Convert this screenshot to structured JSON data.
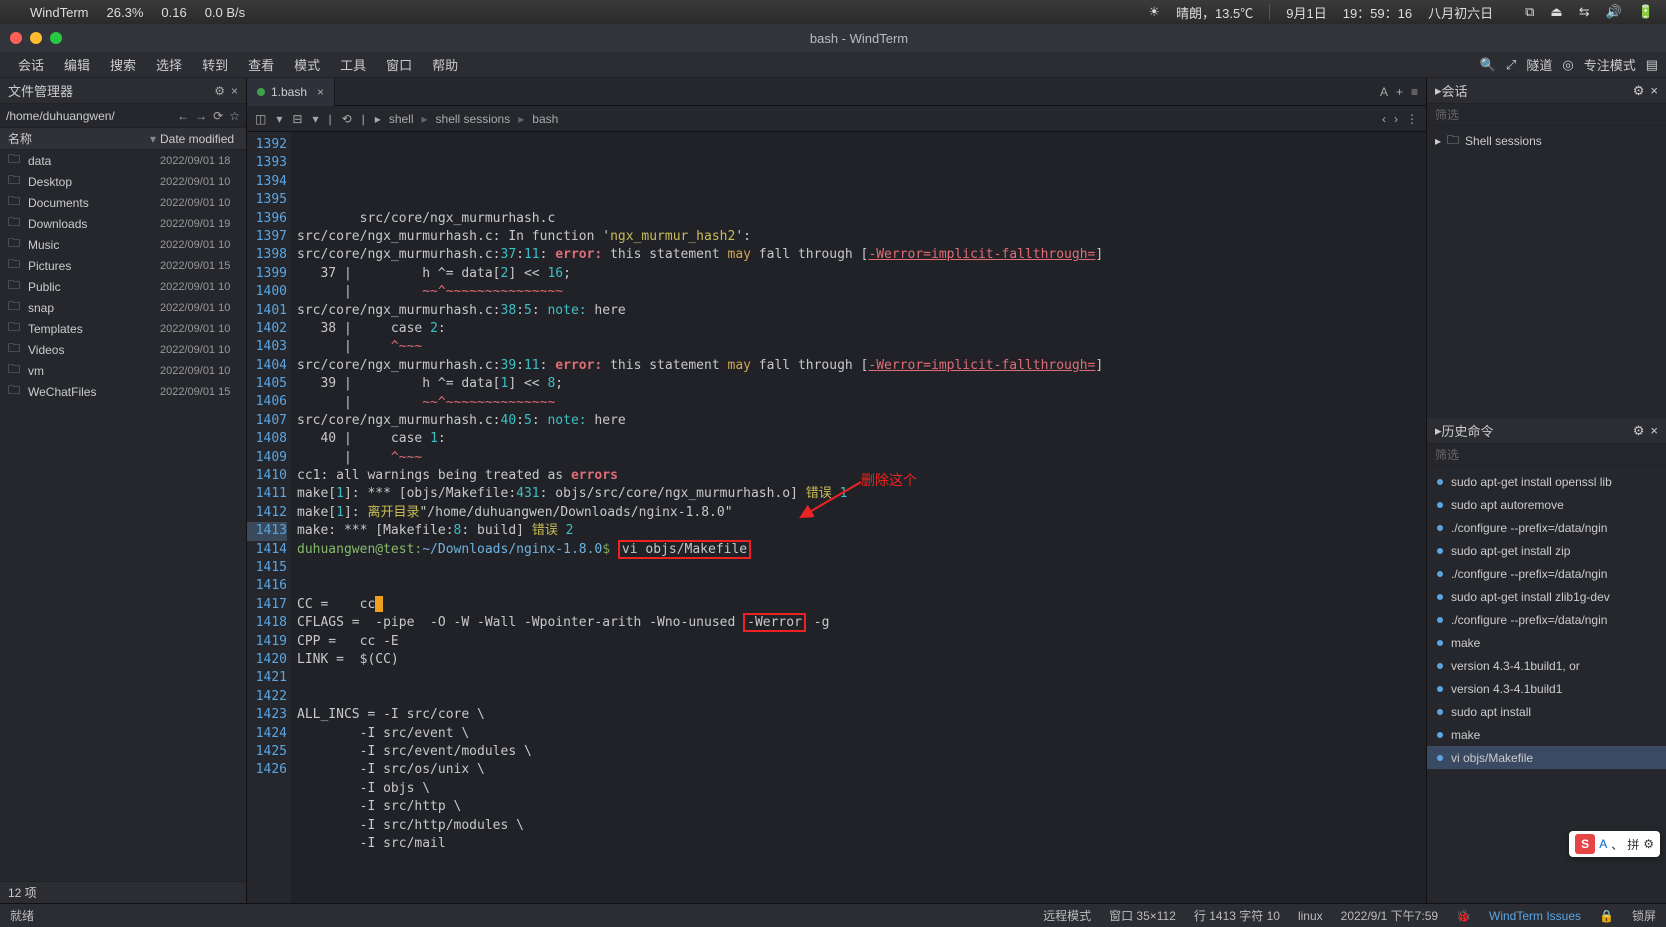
{
  "menubar": {
    "app": "WindTerm",
    "cpu": "26.3%",
    "load": "0.16",
    "net": "0.0 B/s",
    "weather": "晴朗，13.5℃",
    "date": "9月1日",
    "time": "19：59：16",
    "lunar": "八月初六日"
  },
  "titlebar": {
    "title": "bash - WindTerm"
  },
  "appmenu": {
    "items": [
      "会话",
      "编辑",
      "搜索",
      "选择",
      "转到",
      "查看",
      "模式",
      "工具",
      "窗口",
      "帮助"
    ],
    "right": {
      "tunnel": "隧道",
      "focus": "专注模式"
    }
  },
  "left": {
    "title": "文件管理器",
    "path": "/home/duhuangwen/",
    "cols": {
      "name": "名称",
      "date": "Date modified"
    },
    "files": [
      {
        "name": "data",
        "date": "2022/09/01 18"
      },
      {
        "name": "Desktop",
        "date": "2022/09/01 10"
      },
      {
        "name": "Documents",
        "date": "2022/09/01 10"
      },
      {
        "name": "Downloads",
        "date": "2022/09/01 19"
      },
      {
        "name": "Music",
        "date": "2022/09/01 10"
      },
      {
        "name": "Pictures",
        "date": "2022/09/01 15"
      },
      {
        "name": "Public",
        "date": "2022/09/01 10"
      },
      {
        "name": "snap",
        "date": "2022/09/01 10"
      },
      {
        "name": "Templates",
        "date": "2022/09/01 10"
      },
      {
        "name": "Videos",
        "date": "2022/09/01 10"
      },
      {
        "name": "vm",
        "date": "2022/09/01 10"
      },
      {
        "name": "WeChatFiles",
        "date": "2022/09/01 15"
      }
    ],
    "status": "12 项"
  },
  "tab": {
    "label": "1.bash"
  },
  "breadcrumb": [
    "shell",
    "shell sessions",
    "bash"
  ],
  "lines": [
    {
      "n": 1392,
      "segs": [
        {
          "t": "        src/core/ngx_murmurhash.c"
        }
      ]
    },
    {
      "n": 1393,
      "segs": [
        {
          "t": "src/core/ngx_murmurhash.c: In function '"
        },
        {
          "t": "ngx_murmur_hash2",
          "c": "cl-yellow"
        },
        {
          "t": "':"
        }
      ]
    },
    {
      "n": 1394,
      "segs": [
        {
          "t": "src/core/ngx_murmurhash.c:"
        },
        {
          "t": "37",
          "c": "cl-num"
        },
        {
          "t": ":"
        },
        {
          "t": "11",
          "c": "cl-num"
        },
        {
          "t": ": "
        },
        {
          "t": "error:",
          "c": "cl-error"
        },
        {
          "t": " this statement "
        },
        {
          "t": "may",
          "c": "cl-warn"
        },
        {
          "t": " fall through ["
        },
        {
          "t": "-Werror=implicit-fallthrough=",
          "c": "cl-link"
        },
        {
          "t": "]"
        }
      ]
    },
    {
      "n": 1395,
      "segs": [
        {
          "t": "   37 |         h ^= data["
        },
        {
          "t": "2",
          "c": "cl-num"
        },
        {
          "t": "] << "
        },
        {
          "t": "16",
          "c": "cl-num"
        },
        {
          "t": ";"
        }
      ]
    },
    {
      "n": 1396,
      "segs": [
        {
          "t": "      |         ",
          "c": "cl-plain"
        },
        {
          "t": "~~^~~~~~~~~~~~~~~~",
          "c": "cl-red"
        }
      ]
    },
    {
      "n": 1397,
      "segs": [
        {
          "t": "src/core/ngx_murmurhash.c:"
        },
        {
          "t": "38",
          "c": "cl-num"
        },
        {
          "t": ":"
        },
        {
          "t": "5",
          "c": "cl-num"
        },
        {
          "t": ": "
        },
        {
          "t": "note:",
          "c": "cl-note"
        },
        {
          "t": " here"
        }
      ]
    },
    {
      "n": 1398,
      "segs": [
        {
          "t": "   38 |     case "
        },
        {
          "t": "2",
          "c": "cl-num"
        },
        {
          "t": ":"
        }
      ]
    },
    {
      "n": 1399,
      "segs": [
        {
          "t": "      |     ",
          "c": "cl-plain"
        },
        {
          "t": "^~~~",
          "c": "cl-red"
        }
      ]
    },
    {
      "n": 1400,
      "segs": [
        {
          "t": "src/core/ngx_murmurhash.c:"
        },
        {
          "t": "39",
          "c": "cl-num"
        },
        {
          "t": ":"
        },
        {
          "t": "11",
          "c": "cl-num"
        },
        {
          "t": ": "
        },
        {
          "t": "error:",
          "c": "cl-error"
        },
        {
          "t": " this statement "
        },
        {
          "t": "may",
          "c": "cl-warn"
        },
        {
          "t": " fall through ["
        },
        {
          "t": "-Werror=implicit-fallthrough=",
          "c": "cl-link"
        },
        {
          "t": "]"
        }
      ]
    },
    {
      "n": 1401,
      "segs": [
        {
          "t": "   39 |         h ^= data["
        },
        {
          "t": "1",
          "c": "cl-num"
        },
        {
          "t": "] << "
        },
        {
          "t": "8",
          "c": "cl-num"
        },
        {
          "t": ";"
        }
      ]
    },
    {
      "n": 1402,
      "segs": [
        {
          "t": "      |         ",
          "c": "cl-plain"
        },
        {
          "t": "~~^~~~~~~~~~~~~~~",
          "c": "cl-red"
        }
      ]
    },
    {
      "n": 1403,
      "segs": [
        {
          "t": "src/core/ngx_murmurhash.c:"
        },
        {
          "t": "40",
          "c": "cl-num"
        },
        {
          "t": ":"
        },
        {
          "t": "5",
          "c": "cl-num"
        },
        {
          "t": ": "
        },
        {
          "t": "note:",
          "c": "cl-note"
        },
        {
          "t": " here"
        }
      ]
    },
    {
      "n": 1404,
      "segs": [
        {
          "t": "   40 |     case "
        },
        {
          "t": "1",
          "c": "cl-num"
        },
        {
          "t": ":"
        }
      ]
    },
    {
      "n": 1405,
      "segs": [
        {
          "t": "      |     ",
          "c": "cl-plain"
        },
        {
          "t": "^~~~",
          "c": "cl-red"
        }
      ]
    },
    {
      "n": 1406,
      "segs": [
        {
          "t": "cc1: all warnings being treated as "
        },
        {
          "t": "errors",
          "c": "cl-error"
        }
      ]
    },
    {
      "n": 1407,
      "segs": [
        {
          "t": "make["
        },
        {
          "t": "1",
          "c": "cl-num"
        },
        {
          "t": "]: *** [objs/Makefile:"
        },
        {
          "t": "431",
          "c": "cl-num"
        },
        {
          "t": ": objs/src/core/ngx_murmurhash.o] "
        },
        {
          "t": "错误",
          "c": "cl-yellow"
        },
        {
          "t": " "
        },
        {
          "t": "1",
          "c": "cl-num"
        }
      ]
    },
    {
      "n": 1408,
      "segs": [
        {
          "t": "make["
        },
        {
          "t": "1",
          "c": "cl-num"
        },
        {
          "t": "]: "
        },
        {
          "t": "离开目录",
          "c": "cl-yellow"
        },
        {
          "t": "\"/home/duhuangwen/Downloads/nginx-1.8.0\""
        }
      ]
    },
    {
      "n": 1409,
      "segs": [
        {
          "t": "make: *** [Makefile:"
        },
        {
          "t": "8",
          "c": "cl-num"
        },
        {
          "t": ": build] "
        },
        {
          "t": "错误",
          "c": "cl-yellow"
        },
        {
          "t": " "
        },
        {
          "t": "2",
          "c": "cl-num"
        }
      ]
    },
    {
      "n": 1410,
      "hl": true,
      "segs": [
        {
          "t": "duhuangwen@test",
          "c": "cl-bgreen"
        },
        {
          "t": ":",
          "c": "cl-green"
        },
        {
          "t": "~/Downloads/nginx-1.8.0",
          "c": "cl-blue"
        },
        {
          "t": "$",
          "c": "cl-green"
        },
        {
          "t": " "
        },
        {
          "t": "vi objs/Makefile",
          "box": true
        }
      ]
    },
    {
      "n": 1411,
      "segs": [
        {
          "t": ""
        }
      ]
    },
    {
      "n": 1412,
      "segs": [
        {
          "t": ""
        }
      ]
    },
    {
      "n": 1413,
      "mark": true,
      "segs": [
        {
          "t": "CC =    cc",
          "cursor": true
        }
      ]
    },
    {
      "n": 1414,
      "segs": [
        {
          "t": "CFLAGS =  -pipe  -O -W -Wall -Wpointer-arith -Wno-unused "
        },
        {
          "t": "-Werror",
          "box": true
        },
        {
          "t": " -g"
        }
      ]
    },
    {
      "n": 1415,
      "segs": [
        {
          "t": "CPP =   cc -E"
        }
      ]
    },
    {
      "n": 1416,
      "segs": [
        {
          "t": "LINK =  $(CC)"
        }
      ]
    },
    {
      "n": 1417,
      "segs": [
        {
          "t": ""
        }
      ]
    },
    {
      "n": 1418,
      "segs": [
        {
          "t": ""
        }
      ]
    },
    {
      "n": 1419,
      "segs": [
        {
          "t": "ALL_INCS = -I src/core \\\\"
        }
      ]
    },
    {
      "n": 1420,
      "segs": [
        {
          "t": "        -I src/event \\\\"
        }
      ]
    },
    {
      "n": 1421,
      "segs": [
        {
          "t": "        -I src/event/modules \\\\"
        }
      ]
    },
    {
      "n": 1422,
      "segs": [
        {
          "t": "        -I src/os/unix \\\\"
        }
      ]
    },
    {
      "n": 1423,
      "segs": [
        {
          "t": "        -I objs \\\\"
        }
      ]
    },
    {
      "n": 1424,
      "segs": [
        {
          "t": "        -I src/http \\\\"
        }
      ]
    },
    {
      "n": 1425,
      "segs": [
        {
          "t": "        -I src/http/modules \\\\"
        }
      ]
    },
    {
      "n": 1426,
      "segs": [
        {
          "t": "        -I src/mail"
        }
      ]
    }
  ],
  "annotation": "删除这个",
  "right": {
    "sessions_title": "会话",
    "sessions_filter": "筛选",
    "sessions_item": "Shell sessions",
    "history_title": "历史命令",
    "history_filter": "筛选",
    "history": [
      "sudo apt-get install openssl lib",
      "sudo apt autoremove",
      "./configure --prefix=/data/ngin",
      "sudo apt-get install zip",
      "./configure --prefix=/data/ngin",
      "sudo apt-get install zlib1g-dev",
      "./configure --prefix=/data/ngin",
      "make",
      "version 4.3-4.1build1, or",
      "version 4.3-4.1build1",
      "sudo apt install",
      "make",
      "vi objs/Makefile"
    ]
  },
  "statusbar": {
    "ready": "就绪",
    "mode": "远程模式",
    "wsize": "窗口 35×112",
    "pos": "行 1413 字符 10",
    "os": "linux",
    "dt": "2022/9/1 下午7:59",
    "issues": "WindTerm Issues",
    "lock": "锁屏"
  },
  "ime": {
    "s": "S",
    "a": "A",
    "mode": "拼"
  }
}
